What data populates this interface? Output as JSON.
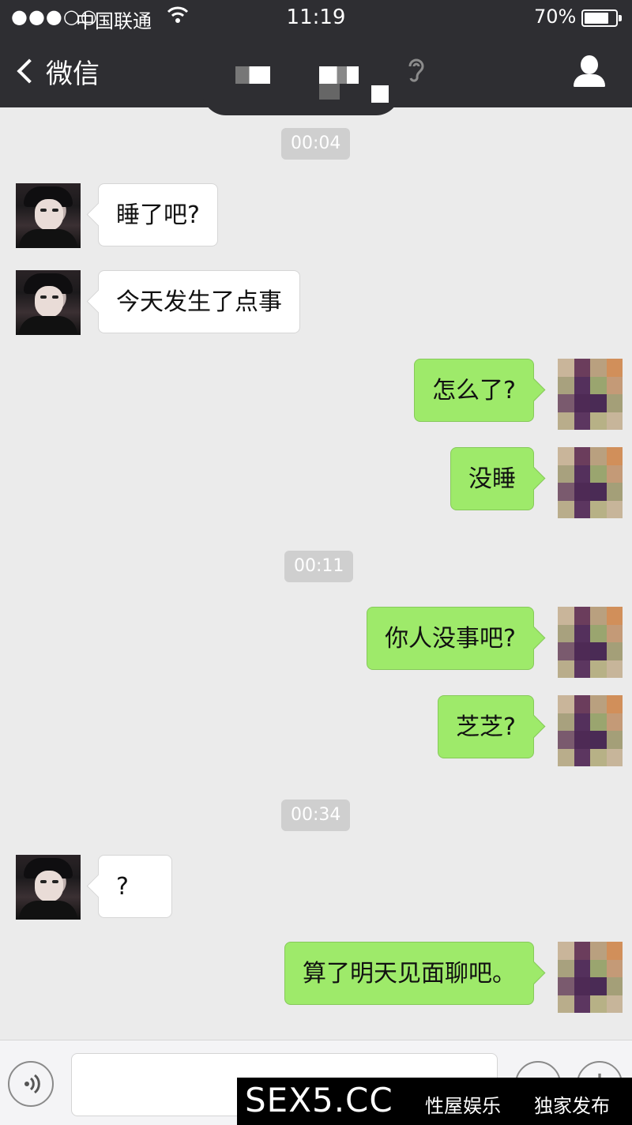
{
  "status_bar": {
    "signal": "●●●○○",
    "carrier": "中国联通",
    "wifi_icon": "wifi-icon",
    "time": "11:19",
    "battery": "70%"
  },
  "nav": {
    "back_label": "微信",
    "title_obscured": true,
    "profile_icon": "person-icon"
  },
  "chat": {
    "timestamps": [
      "00:04",
      "00:11",
      "00:34"
    ],
    "messages": [
      {
        "from": "them",
        "text": "睡了吧?"
      },
      {
        "from": "them",
        "text": "今天发生了点事"
      },
      {
        "from": "me",
        "text": "怎么了?"
      },
      {
        "from": "me",
        "text": "没睡"
      },
      {
        "from": "me",
        "text": "你人没事吧?"
      },
      {
        "from": "me",
        "text": "芝芝?"
      },
      {
        "from": "them",
        "text": "?"
      },
      {
        "from": "me",
        "text": "算了明天见面聊吧。"
      }
    ]
  },
  "input_bar": {
    "voice_icon": "voice-icon",
    "emoji_icon": "emoji-icon",
    "plus_icon": "plus-icon"
  },
  "watermark": {
    "site": "SEX5.CC",
    "tag1": "性屋娱乐",
    "tag2": "独家发布"
  }
}
